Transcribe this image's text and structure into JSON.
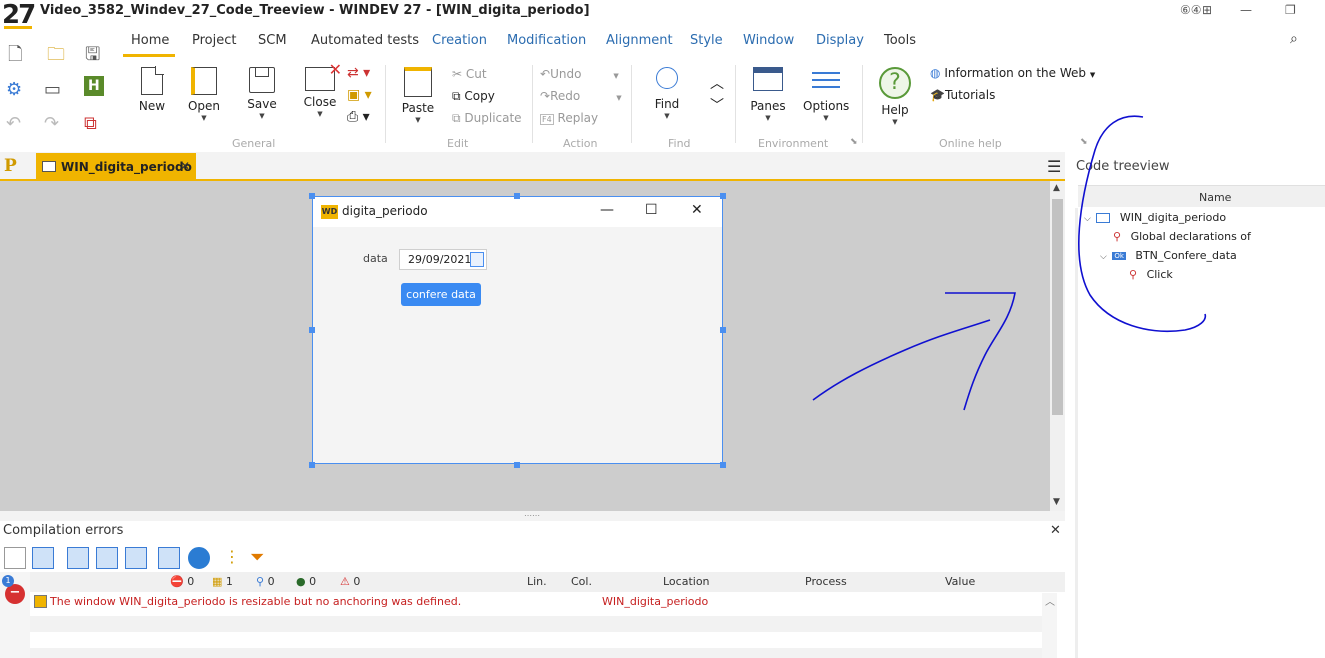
{
  "window": {
    "logo": "27",
    "title": "Video_3582_Windev_27_Code_Treeview - WINDEV 27 - [WIN_digita_periodo]"
  },
  "ribbon": {
    "tabs": [
      {
        "label": "Home",
        "active": true
      },
      {
        "label": "Project"
      },
      {
        "label": "SCM"
      },
      {
        "label": "Automated tests"
      },
      {
        "label": "Creation"
      },
      {
        "label": "Modification"
      },
      {
        "label": "Alignment"
      },
      {
        "label": "Style"
      },
      {
        "label": "Window"
      },
      {
        "label": "Display"
      },
      {
        "label": "Tools"
      }
    ],
    "general": {
      "new": "New",
      "open": "Open",
      "save": "Save",
      "close": "Close",
      "group": "General"
    },
    "edit": {
      "paste": "Paste",
      "cut": "Cut",
      "copy": "Copy",
      "duplicate": "Duplicate",
      "group": "Edit"
    },
    "action": {
      "undo": "Undo",
      "redo": "Redo",
      "replay": "Replay",
      "replay_key": "F4",
      "group": "Action"
    },
    "find": {
      "find": "Find",
      "group": "Find"
    },
    "environment": {
      "panes": "Panes",
      "options": "Options",
      "group": "Environment"
    },
    "online_help": {
      "help": "Help",
      "info_web": "Information on the Web",
      "tutorials": "Tutorials",
      "group": "Online help"
    }
  },
  "editor": {
    "tab_label": "WIN_digita_periodo",
    "designed_window": {
      "title": "digita_periodo",
      "badge": "WD",
      "field_label": "data",
      "date_value": "29/09/2021",
      "button_label": "confere data"
    }
  },
  "compilation": {
    "title": "Compilation errors",
    "counts": {
      "errors": "0",
      "warnings": "1",
      "info": "0",
      "actions": "0",
      "alerts": "0"
    },
    "badge_count": "1",
    "columns": {
      "lin": "Lin.",
      "col": "Col.",
      "location": "Location",
      "process": "Process",
      "value": "Value"
    },
    "rows": [
      {
        "message": "The window WIN_digita_periodo is resizable but no anchoring was defined.",
        "location": "WIN_digita_periodo"
      }
    ]
  },
  "treeview": {
    "title": "Code treeview",
    "column": "Name",
    "items": [
      {
        "label": "WIN_digita_periodo"
      },
      {
        "label": "Global declarations of"
      },
      {
        "label": "BTN_Confere_data",
        "badge": "Ok"
      },
      {
        "label": "Click"
      }
    ]
  },
  "icons": {
    "accent": "#f0b400",
    "link_blue": "#2b6cb0",
    "error_red": "#c62020",
    "annotation_ink": "#1010d0"
  }
}
